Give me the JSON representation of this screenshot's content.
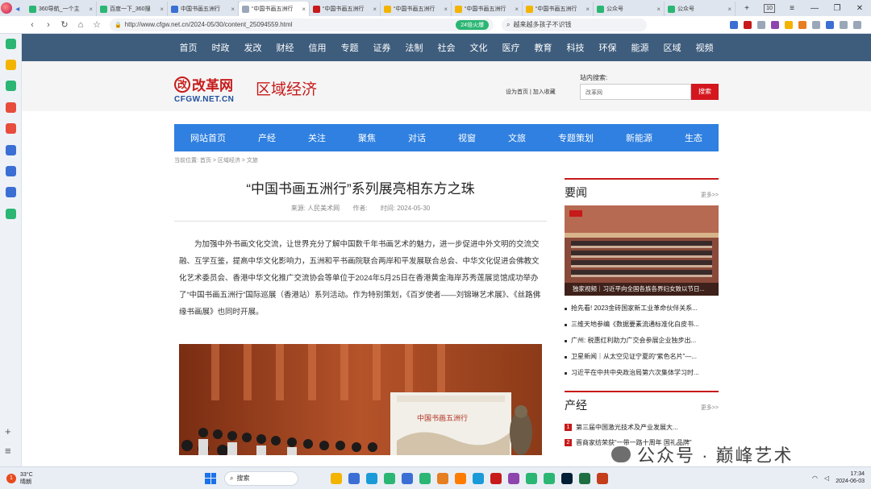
{
  "browser": {
    "tabs": [
      {
        "label": "360导航_一个主",
        "color": "#2bb673"
      },
      {
        "label": "百度一下_360搜",
        "color": "#2bb673"
      },
      {
        "label": "中国书画五洲行",
        "color": "#3b6fd4"
      },
      {
        "label": "“中国书画五洲行",
        "color": "#9aa7b8",
        "active": true
      },
      {
        "label": "“中国书画五洲行",
        "color": "#c71a1a"
      },
      {
        "label": "“中国书画五洲行",
        "color": "#f3b400"
      },
      {
        "label": "“中国书画五洲行",
        "color": "#f3b400"
      },
      {
        "label": "“中国书画五洲行",
        "color": "#f3b400"
      },
      {
        "label": "公众号",
        "color": "#2bb673"
      },
      {
        "label": "公众号",
        "color": "#2bb673"
      }
    ],
    "tab_count": "10",
    "url": "http://www.cfgw.net.cn/2024-05/30/content_25094559.html",
    "badge": "24倍火爆",
    "search_query": "越来越多孩子不识钱"
  },
  "site": {
    "top_nav": [
      "首页",
      "时政",
      "发改",
      "财经",
      "信用",
      "专题",
      "证券",
      "法制",
      "社会",
      "文化",
      "医疗",
      "教育",
      "科技",
      "环保",
      "能源",
      "区域",
      "视频"
    ],
    "logo_name": "改革网",
    "logo_mark": "改",
    "logo_domain": "CFGW.NET.CN",
    "section_title": "区域经济",
    "header_links": "设为首页 | 加入收藏",
    "search_label": "站内搜索:",
    "search_placeholder": "改革网",
    "search_button": "搜索",
    "channel_nav": [
      "网站首页",
      "产经",
      "关注",
      "聚焦",
      "对话",
      "视窗",
      "文旅",
      "专题策划",
      "新能源",
      "生态"
    ],
    "breadcrumb": "当前位置: 首页 > 区域经济 > 文旅"
  },
  "article": {
    "title": "“中国书画五洲行”系列展亮相东方之珠",
    "source": "来源: 人民美术网",
    "author": "作者:",
    "time": "时间: 2024-05-30",
    "body": "为加强中外书画文化交流，让世界充分了解中国数千年书画艺术的魅力，进一步促进中外文明的交流交融、互学互鉴，提高中华文化影响力，五洲和平书画院联合两岸和平发展联合总会、中华文化促进会佛教文化艺术委员会、香港中华文化推广交流协会等单位于2024年5月25日在香港黄金海岸苏秀莲展览馆成功举办了“中国书画五洲行”国际巡展（香港站）系列活动。作为特别策划，《百岁使者——刘锦琳艺术展》、《丝路佛缘书画展》也同时开展。",
    "banner_text": "中国书画五洲行"
  },
  "sidebar": {
    "news_title": "要闻",
    "more": "更多>>",
    "photo_caption": "独家视频｜习近平向全国各族各界妇女致以节日...",
    "news": [
      "抢先看! 2023金砖国家新工业革命伙伴关系...",
      "三维天地参编《数据要素流通标准化白皮书...",
      "广州: 税惠红利助力广交会参展企业独步出...",
      "卫星新闻｜从太空见证宁夏的“紫色名片”—...",
      "习近平在中共中央政治局第六次集体学习时..."
    ],
    "industry_title": "产经",
    "industry": [
      {
        "num": "1",
        "text": "第三届中国激光技术及产业发展大..."
      },
      {
        "num": "2",
        "text": "晋商家纺荣获“一带一路十周年 国礼品牌”"
      }
    ]
  },
  "taskbar": {
    "temp": "33°C",
    "weather": "晴朗",
    "search": "搜索",
    "time": "17:34",
    "date": "2024-06-03"
  },
  "watermark": "公众号 · 巅峰艺术"
}
